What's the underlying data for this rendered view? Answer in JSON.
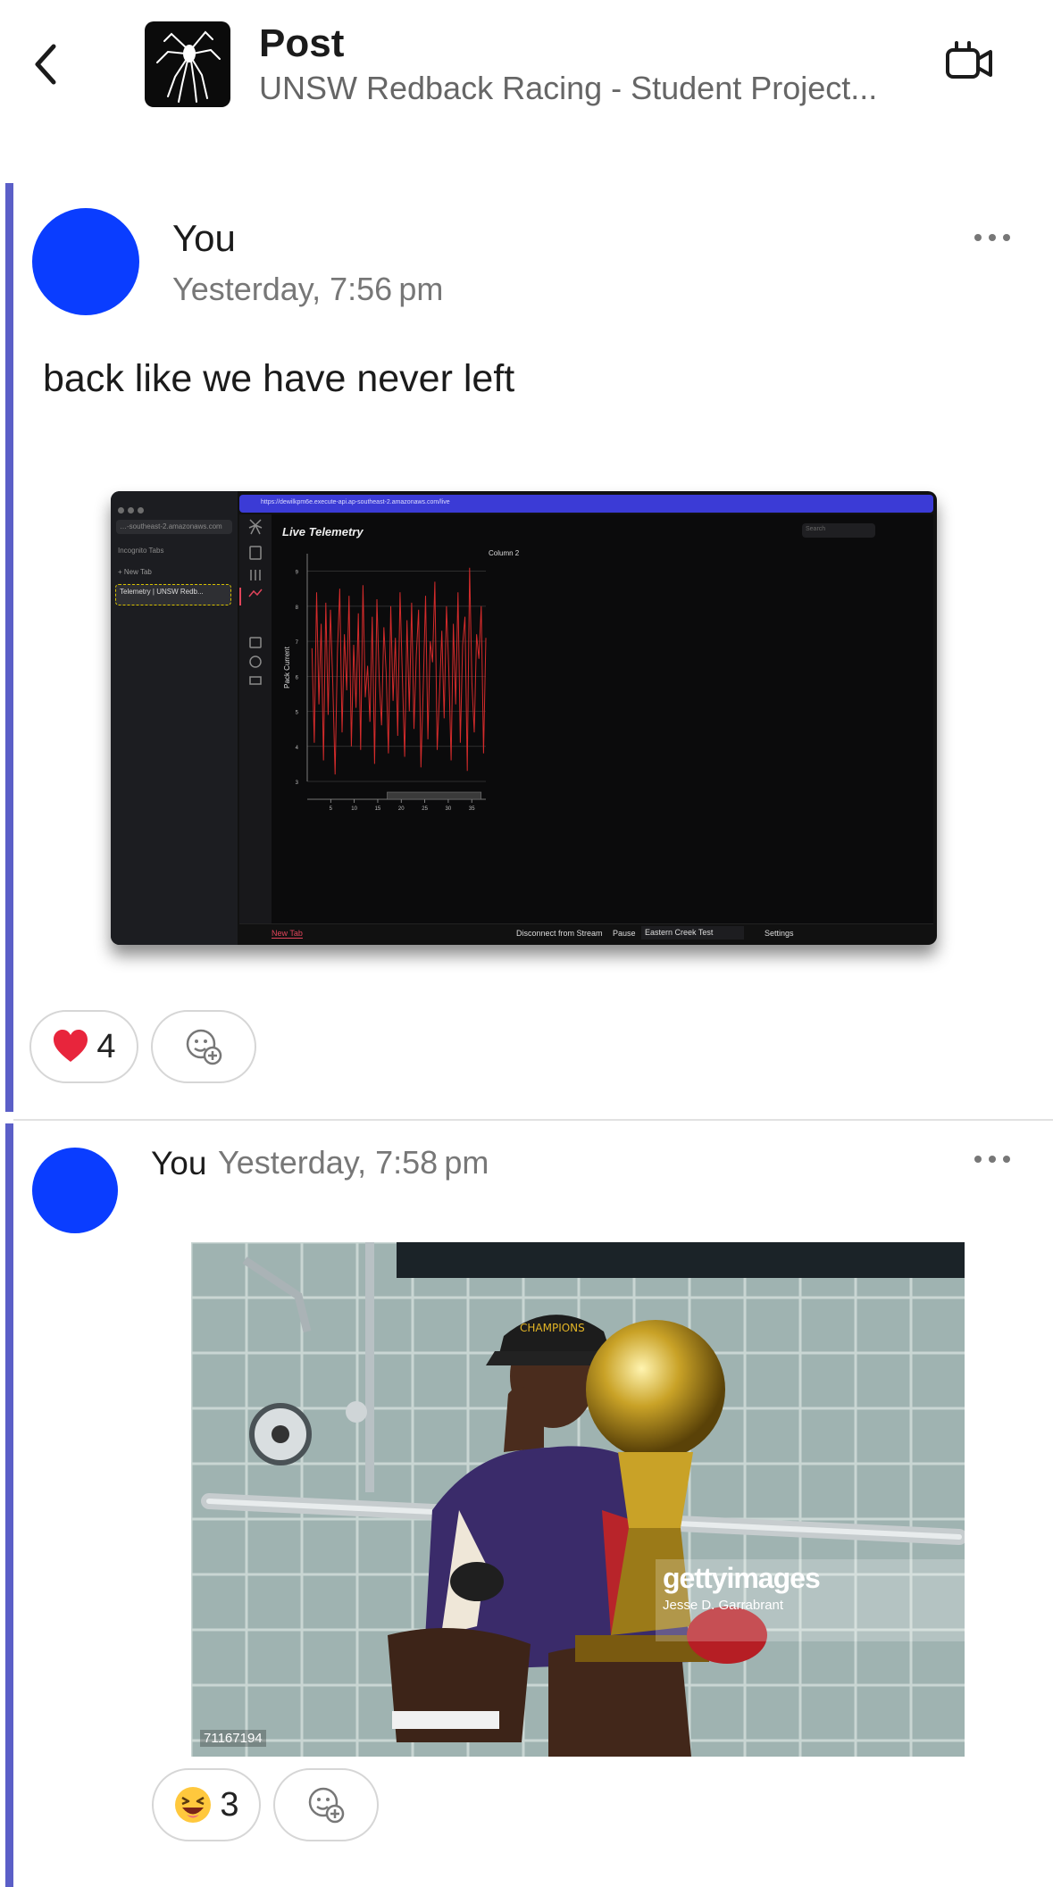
{
  "header": {
    "title": "Post",
    "subtitle": "UNSW Redback Racing - Student Project..."
  },
  "posts": [
    {
      "author": "You",
      "time": "Yesterday, 7:56 pm",
      "text": "back like we have never left",
      "reactions": [
        {
          "icon": "heart-icon",
          "count": "4"
        }
      ]
    },
    {
      "author": "You",
      "time": "Yesterday, 7:58 pm",
      "reactions": [
        {
          "icon": "laughing-emoji-icon",
          "count": "3"
        }
      ]
    }
  ],
  "screenshot": {
    "url_mini": "…-southeast-2.amazonaws.com",
    "incognito_label": "Incognito Tabs",
    "new_tab_label": "+  New Tab",
    "tab_title": "Telemetry | UNSW Redb...",
    "url": "https://dewilkpm6e.execute-api.ap-southeast-2.amazonaws.com/live",
    "app_title": "Live Telemetry",
    "search_placeholder": "Search",
    "bottom_tab": "New Tab",
    "disconnect_label": "Disconnect from Stream",
    "pause_label": "Pause",
    "session_select": "Eastern Creek Test",
    "settings_label": "Settings"
  },
  "chart_data": {
    "type": "line",
    "title": "",
    "legend": [
      "Column 2"
    ],
    "xlabel": "",
    "ylabel": "Pack Current",
    "xlim": [
      0,
      38
    ],
    "ylim": [
      3,
      9.5
    ],
    "x_ticks": [
      "5",
      "10",
      "15",
      "20",
      "25",
      "30",
      "35"
    ],
    "y_ticks": [
      "3",
      "4",
      "5",
      "6",
      "7",
      "8",
      "9"
    ],
    "series": [
      {
        "name": "Column 2",
        "color": "#d42b2b",
        "values": [
          6.8,
          4.1,
          8.4,
          5.2,
          7.5,
          3.6,
          8.1,
          4.9,
          7.9,
          5.8,
          3.2,
          6.7,
          8.5,
          4.4,
          7.2,
          5.6,
          8.3,
          4.0,
          6.9,
          5.1,
          7.8,
          3.9,
          8.6,
          5.4,
          6.3,
          4.7,
          7.7,
          3.5,
          8.2,
          5.9,
          4.6,
          7.4,
          6.1,
          3.8,
          8.0,
          5.3,
          7.1,
          4.3,
          8.4,
          6.0,
          3.7,
          7.6,
          5.0,
          8.1,
          4.5,
          6.6,
          7.9,
          3.4,
          5.7,
          8.3,
          4.2,
          7.0,
          6.4,
          8.7,
          3.9,
          5.5,
          7.3,
          4.8,
          8.0,
          6.2,
          3.6,
          7.5,
          5.2,
          8.4,
          4.1,
          6.9,
          7.7,
          3.3,
          9.1,
          5.8,
          4.4,
          7.2,
          6.5,
          8.0,
          3.8,
          7.1
        ]
      }
    ]
  },
  "photo": {
    "watermark_brand": "gettyimages",
    "watermark_credit": "Jesse D. Garrabrant",
    "image_id": "71167194"
  }
}
